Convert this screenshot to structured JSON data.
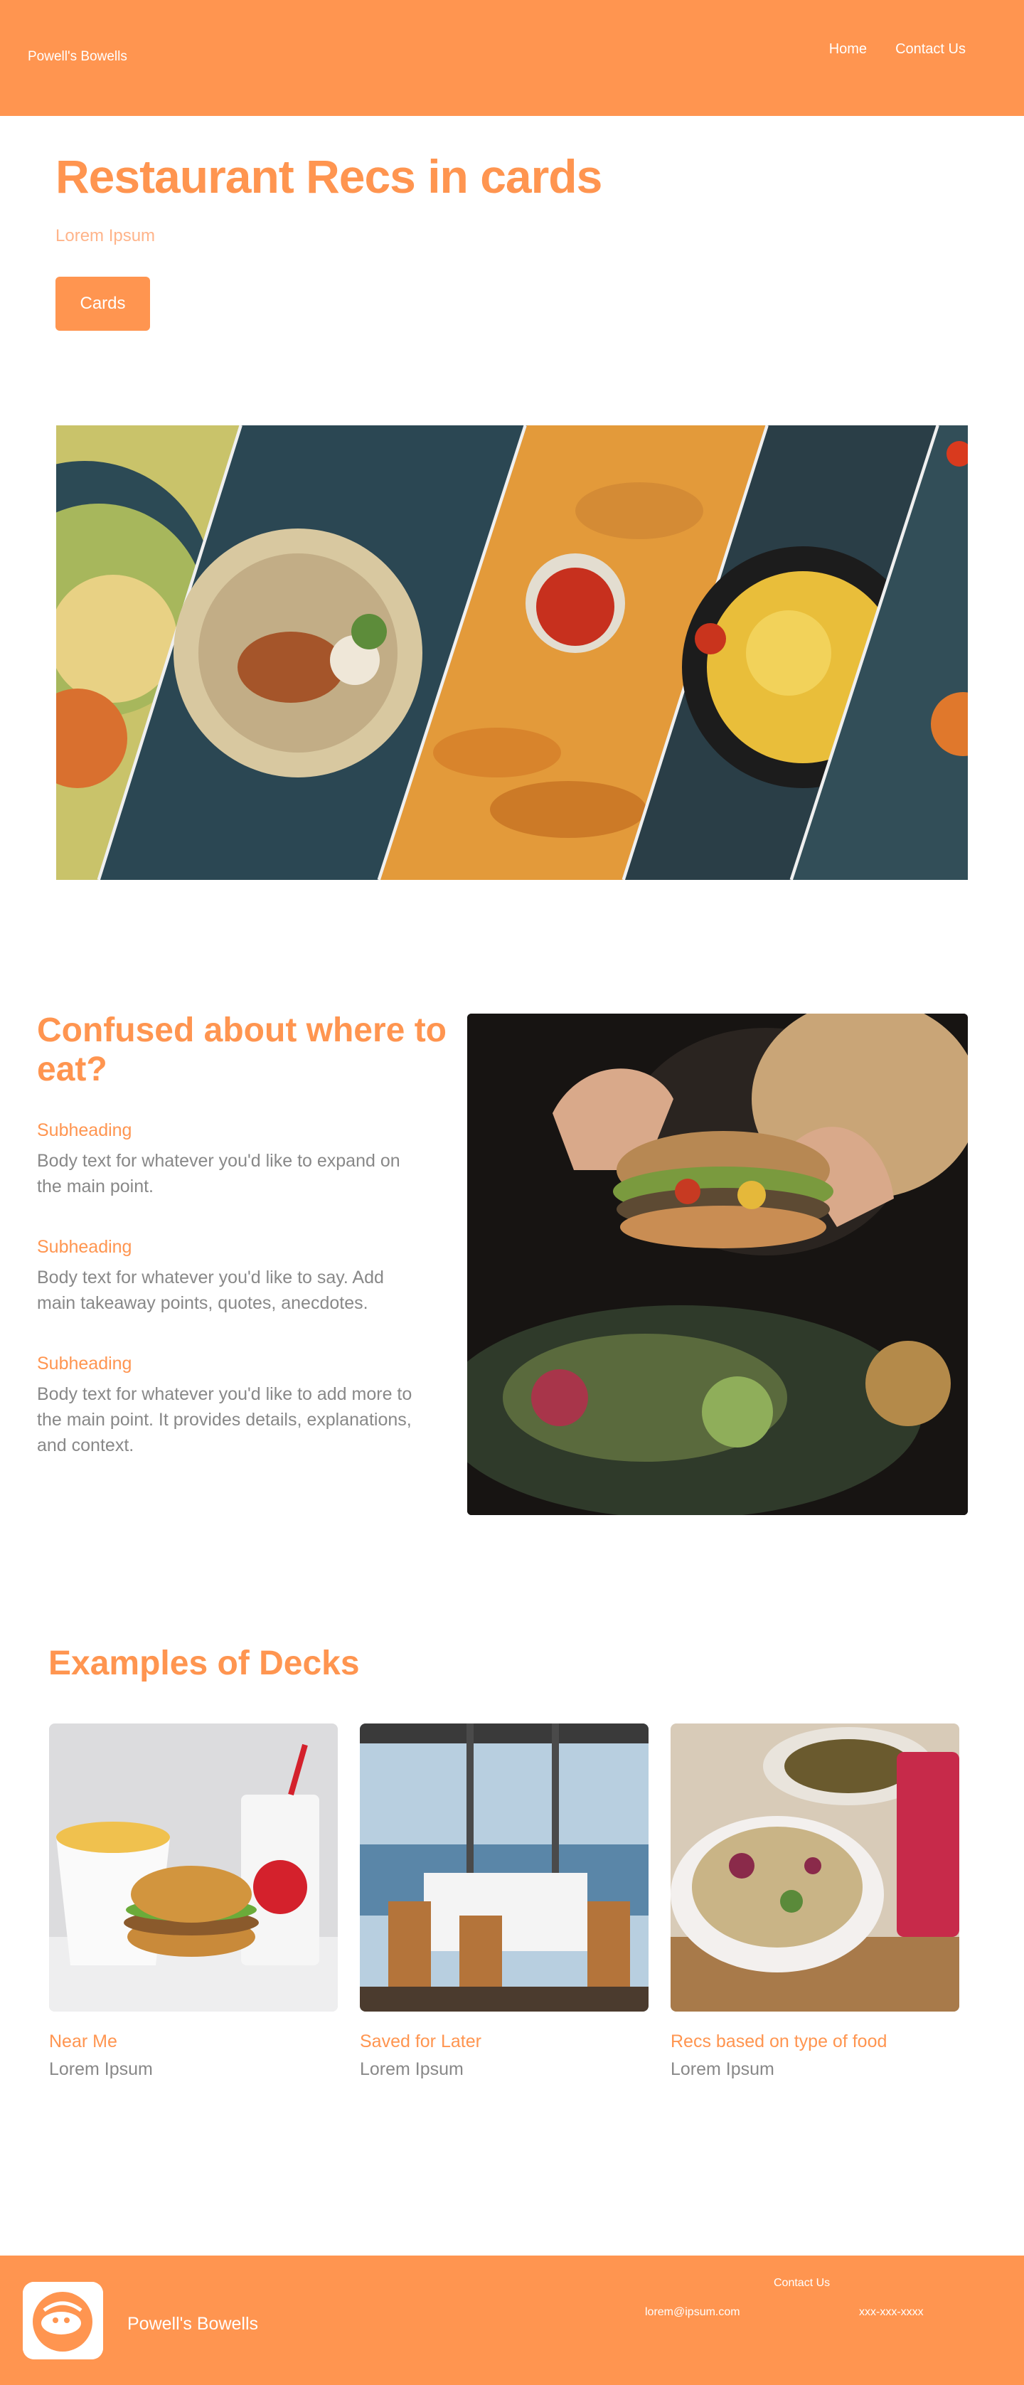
{
  "header": {
    "brand": "Powell's Bowells",
    "nav": [
      "Home",
      "Contact Us"
    ]
  },
  "hero": {
    "title": "Restaurant Recs in cards",
    "subtitle": "Lorem Ipsum",
    "button_label": "Cards"
  },
  "features": {
    "title": "Confused about where to eat?",
    "items": [
      {
        "heading": "Subheading",
        "body": "Body text for whatever you'd like to expand on the main point."
      },
      {
        "heading": "Subheading",
        "body": "Body text for whatever you'd like to say. Add main takeaway points, quotes, anecdotes."
      },
      {
        "heading": "Subheading",
        "body": "Body text for whatever you'd like to add more to the main point. It provides details, explanations, and context."
      }
    ]
  },
  "decks": {
    "title": "Examples of Decks",
    "cards": [
      {
        "title": "Near Me",
        "subtitle": "Lorem Ipsum"
      },
      {
        "title": "Saved for Later",
        "subtitle": "Lorem Ipsum"
      },
      {
        "title": "Recs based on type of food",
        "subtitle": "Lorem Ipsum"
      }
    ]
  },
  "footer": {
    "brand": "Powell's Bowells",
    "contact_title": "Contact Us",
    "email": "lorem@ipsum.com",
    "phone": "xxx-xxx-xxxx"
  },
  "colors": {
    "accent": "#ff9550",
    "text_muted": "#888888"
  },
  "icons": [
    "logo-icon"
  ]
}
